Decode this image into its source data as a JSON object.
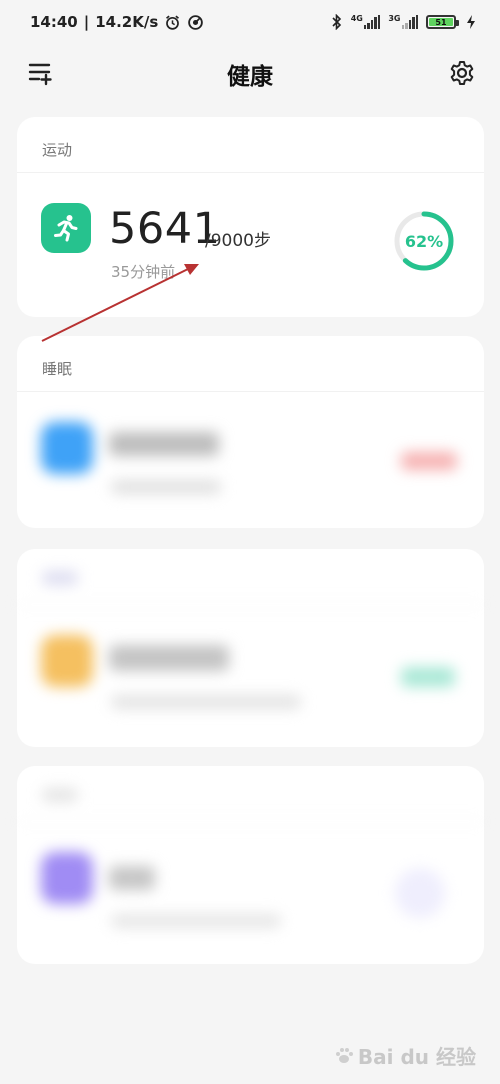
{
  "status_bar": {
    "time": "14:40",
    "net_speed": "14.2K/s",
    "sim1_type": "4G",
    "sim2_type": "3G",
    "battery": "51"
  },
  "header": {
    "title": "健康"
  },
  "steps_card": {
    "label": "运动",
    "steps": "5641",
    "goal": "/9000步",
    "updated": "35分钟前",
    "percent_text": "62%",
    "progress": 0.62,
    "accent": "#26c28e"
  },
  "sleep_card": {
    "label": "睡眠",
    "accent": "#3fa2f7"
  },
  "card3": {
    "accent": "#f5c060"
  },
  "card4": {
    "accent": "#a08cf4"
  },
  "watermark": {
    "text": "Bai du 经验"
  }
}
